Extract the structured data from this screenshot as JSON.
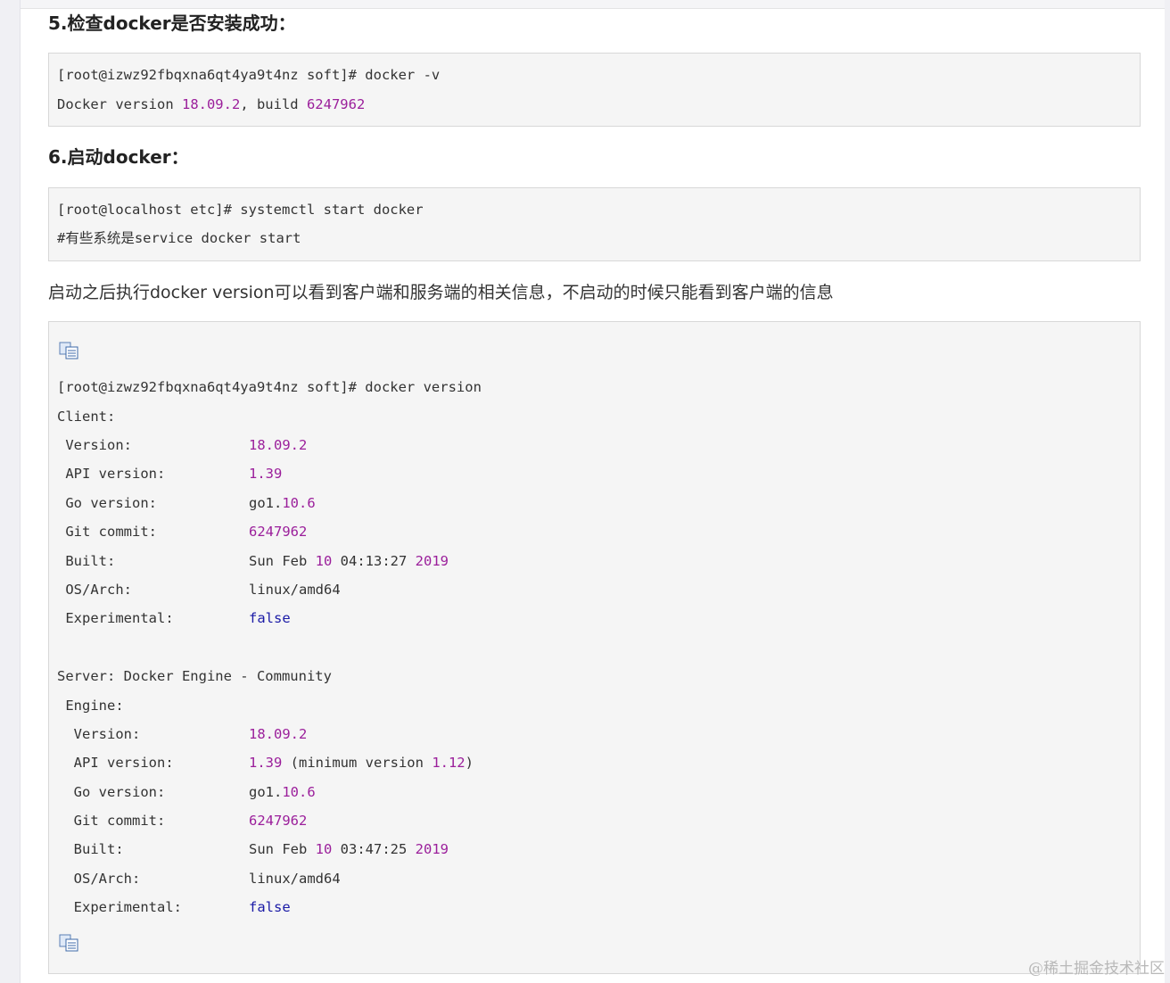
{
  "sections": {
    "step5_title": "5.检查docker是否安装成功：",
    "step6_title": "6.启动docker：",
    "paragraph": "启动之后执行docker version可以看到客户端和服务端的相关信息，不启动的时候只能看到客户端的信息"
  },
  "code1": {
    "line1": "[root@izwz92fbqxna6qt4ya9t4nz soft]# docker -v",
    "line2_a": "Docker version ",
    "line2_b": "18.09.2",
    "line2_c": ", build ",
    "line2_d": "6247962"
  },
  "code2": {
    "line1": "[root@localhost etc]# systemctl start docker",
    "line2": "#有些系统是service docker start"
  },
  "code3": {
    "prompt": "[root@izwz92fbqxna6qt4ya9t4nz soft]# docker version",
    "client_header": "Client:",
    "client": {
      "version_label": " Version:",
      "version_value": "18.09.2",
      "api_label": " API version:",
      "api_value": "1.39",
      "go_label": " Go version:",
      "go_prefix": "go1.",
      "go_num": "10.6",
      "git_label": " Git commit:",
      "git_value": "6247962",
      "built_label": " Built:",
      "built_prefix": "Sun Feb ",
      "built_day": "10",
      "built_time": " 04:13:27 ",
      "built_year": "2019",
      "os_label": " OS/Arch:",
      "os_value": "linux/amd64",
      "exp_label": " Experimental:",
      "exp_value": "false"
    },
    "server_header": "Server: Docker Engine - Community",
    "engine_header": " Engine:",
    "server": {
      "version_label": "  Version:",
      "version_value": "18.09.2",
      "api_label": "  API version:",
      "api_value": "1.39",
      "api_min_text": " (minimum version ",
      "api_min_num": "1.12",
      "api_min_close": ")",
      "go_label": "  Go version:",
      "go_prefix": "go1.",
      "go_num": "10.6",
      "git_label": "  Git commit:",
      "git_value": "6247962",
      "built_label": "  Built:",
      "built_prefix": "Sun Feb ",
      "built_day": "10",
      "built_time": " 03:47:25 ",
      "built_year": "2019",
      "os_label": "  OS/Arch:",
      "os_value": "linux/amd64",
      "exp_label": "  Experimental:",
      "exp_value": "false"
    }
  },
  "icons": {
    "copy": "copy-code-icon"
  },
  "watermark": "@稀土掘金技术社区",
  "colors": {
    "number": "#9b1f9b",
    "keyword": "#1a1aa6",
    "code_bg": "#f5f5f5"
  }
}
